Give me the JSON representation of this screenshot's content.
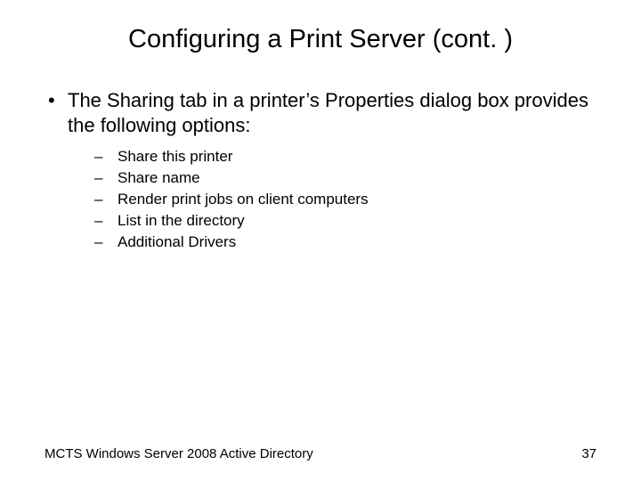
{
  "title": "Configuring a Print Server (cont. )",
  "main_point": "The Sharing tab in a printer’s Properties dialog box provides the following options:",
  "sub_items": [
    "Share this printer",
    "Share name",
    "Render print jobs on client computers",
    "List in the directory",
    "Additional Drivers"
  ],
  "footer_left": "MCTS Windows Server 2008 Active Directory",
  "footer_right": "37"
}
